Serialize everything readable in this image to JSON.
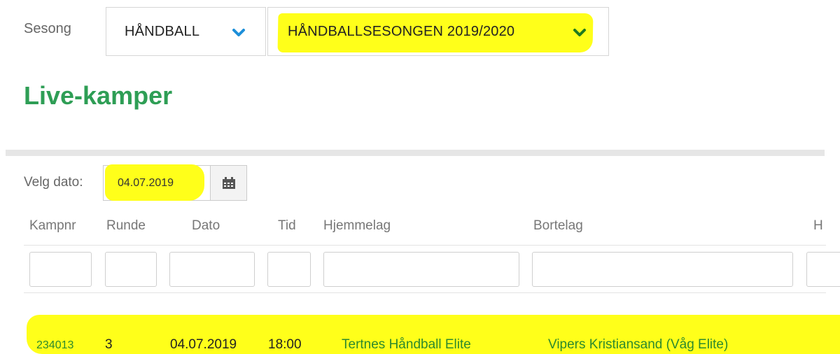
{
  "season": {
    "label": "Sesong",
    "sport_value": "HÅNDBALL",
    "season_value": "HÅNDBALLSESONGEN 2019/2020"
  },
  "page": {
    "title": "Live-kamper"
  },
  "date_picker": {
    "label": "Velg dato:",
    "value": "04.07.2019",
    "icon": "calendar-icon"
  },
  "table": {
    "columns": [
      "Kampnr",
      "Runde",
      "Dato",
      "Tid",
      "Hjemmelag",
      "Bortelag",
      "H"
    ],
    "rows": [
      {
        "kampnr": "234013",
        "runde": "3",
        "dato": "04.07.2019",
        "tid": "18:00",
        "hjemmelag": "Tertnes Håndball Elite",
        "bortelag": "Vipers Kristiansand (Våg Elite)"
      }
    ]
  },
  "colors": {
    "accent_green": "#2e9e55",
    "link_green": "#2d8a2d",
    "chevron_blue": "#1d8fd9",
    "highlight_yellow": "#ffff1a"
  }
}
